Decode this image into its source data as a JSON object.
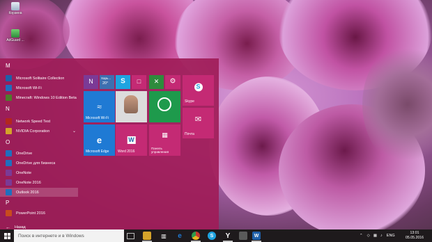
{
  "desktop": {
    "icons": [
      {
        "label": "Корзина",
        "icon": "recycle-bin-icon"
      },
      {
        "label": "AdGuard ...",
        "icon": "app-shortcut-icon"
      }
    ]
  },
  "start_menu": {
    "letters": [
      "M",
      "N",
      "O",
      "P"
    ],
    "apps": [
      {
        "label": "Microsoft Solitaire Collection",
        "icon": "solitaire-icon",
        "color": "#1f5fa8"
      },
      {
        "label": "Microsoft Wi-Fi",
        "icon": "wifi-icon",
        "color": "#1f6fbe"
      },
      {
        "label": "Minecraft: Windows 10 Edition Beta",
        "icon": "minecraft-icon",
        "color": "#4d7d2b"
      },
      {
        "label": "Network Speed Test",
        "icon": "speed-test-icon",
        "color": "#b3261e"
      },
      {
        "label": "NVIDIA Corporation",
        "icon": "folder-icon",
        "color": "#d4a32a",
        "expandable": true
      },
      {
        "label": "OneDrive",
        "icon": "onedrive-icon",
        "color": "#1f6fbe"
      },
      {
        "label": "OneDrive для бизнеса",
        "icon": "onedrive-business-icon",
        "color": "#1f6fbe"
      },
      {
        "label": "OneNote",
        "icon": "onenote-icon",
        "color": "#7b3a96"
      },
      {
        "label": "OneNote 2016",
        "icon": "onenote-2016-icon",
        "color": "#7b3a96"
      },
      {
        "label": "Outlook 2016",
        "icon": "outlook-icon",
        "color": "#1f6fbe",
        "selected": true
      },
      {
        "label": "PowerPoint 2016",
        "icon": "powerpoint-icon",
        "color": "#c84b1e"
      }
    ],
    "back_label": "Назад",
    "tiles": {
      "onenote": {
        "label": "",
        "icon": "onenote-tile-icon",
        "color": "#7b3a96"
      },
      "weather": {
        "line1": "Харь...",
        "line2": "20°",
        "icon": "weather-icon",
        "color": "#3d6fb0"
      },
      "skype_small": {
        "label": "",
        "icon": "skype-icon",
        "color": "#1ea4e0"
      },
      "photos": {
        "label": "",
        "icon": "photos-icon",
        "color": "#c42a74"
      },
      "xbox": {
        "label": "",
        "icon": "xbox-icon",
        "color": "#2e8b3c"
      },
      "settings": {
        "label": "",
        "icon": "gear-icon",
        "color": "#c42a74"
      },
      "skype": {
        "label": "Skype",
        "icon": "skype-icon",
        "color": "#c42a74"
      },
      "wifi": {
        "label": "Microsoft Wi-Fi",
        "icon": "wifi-icon",
        "color": "#1f7ad4"
      },
      "people": {
        "label": "",
        "icon": "people-icon",
        "color": "#dcdcdc"
      },
      "store": {
        "label": "",
        "icon": "store-icon",
        "color": "#1e9a4c"
      },
      "mail": {
        "label": "Почта",
        "icon": "mail-icon",
        "color": "#c42a74"
      },
      "edge": {
        "label": "Microsoft Edge",
        "icon": "edge-icon",
        "color": "#1f7ad4"
      },
      "word": {
        "label": "Word 2016",
        "icon": "word-icon",
        "color": "#c42a74"
      },
      "control": {
        "label": "Панель управления",
        "icon": "control-panel-icon",
        "color": "#c42a74"
      }
    }
  },
  "taskbar": {
    "search_placeholder": "Поиск в интернете и в Windows",
    "pinned": [
      {
        "icon": "task-view-icon",
        "color": "#2a2628",
        "open": false
      },
      {
        "icon": "file-explorer-icon",
        "color": "#d4a32a",
        "open": true
      },
      {
        "icon": "store-icon",
        "color": "#2a2628",
        "open": false
      },
      {
        "icon": "edge-icon",
        "color": "#1f7ad4",
        "open": false
      },
      {
        "icon": "chrome-icon",
        "color": "#c6382e",
        "open": true
      },
      {
        "icon": "skype-icon",
        "color": "#1ea4e0",
        "open": false
      },
      {
        "icon": "yandex-icon",
        "color": "#d9262a",
        "open": true
      },
      {
        "icon": "app-icon",
        "color": "#3a3a3a",
        "open": false
      },
      {
        "icon": "app-icon",
        "color": "#4a4a4a",
        "open": false
      },
      {
        "icon": "app-icon",
        "color": "#5a5a5a",
        "open": false
      },
      {
        "icon": "word-icon",
        "color": "#1f5fa8",
        "open": true
      }
    ],
    "tray": {
      "language": "ENG",
      "time": "13:01",
      "date": "05.05.2016",
      "icons": [
        "chevron-up-icon",
        "dropbox-icon",
        "network-icon",
        "volume-icon",
        "battery-icon"
      ]
    }
  }
}
